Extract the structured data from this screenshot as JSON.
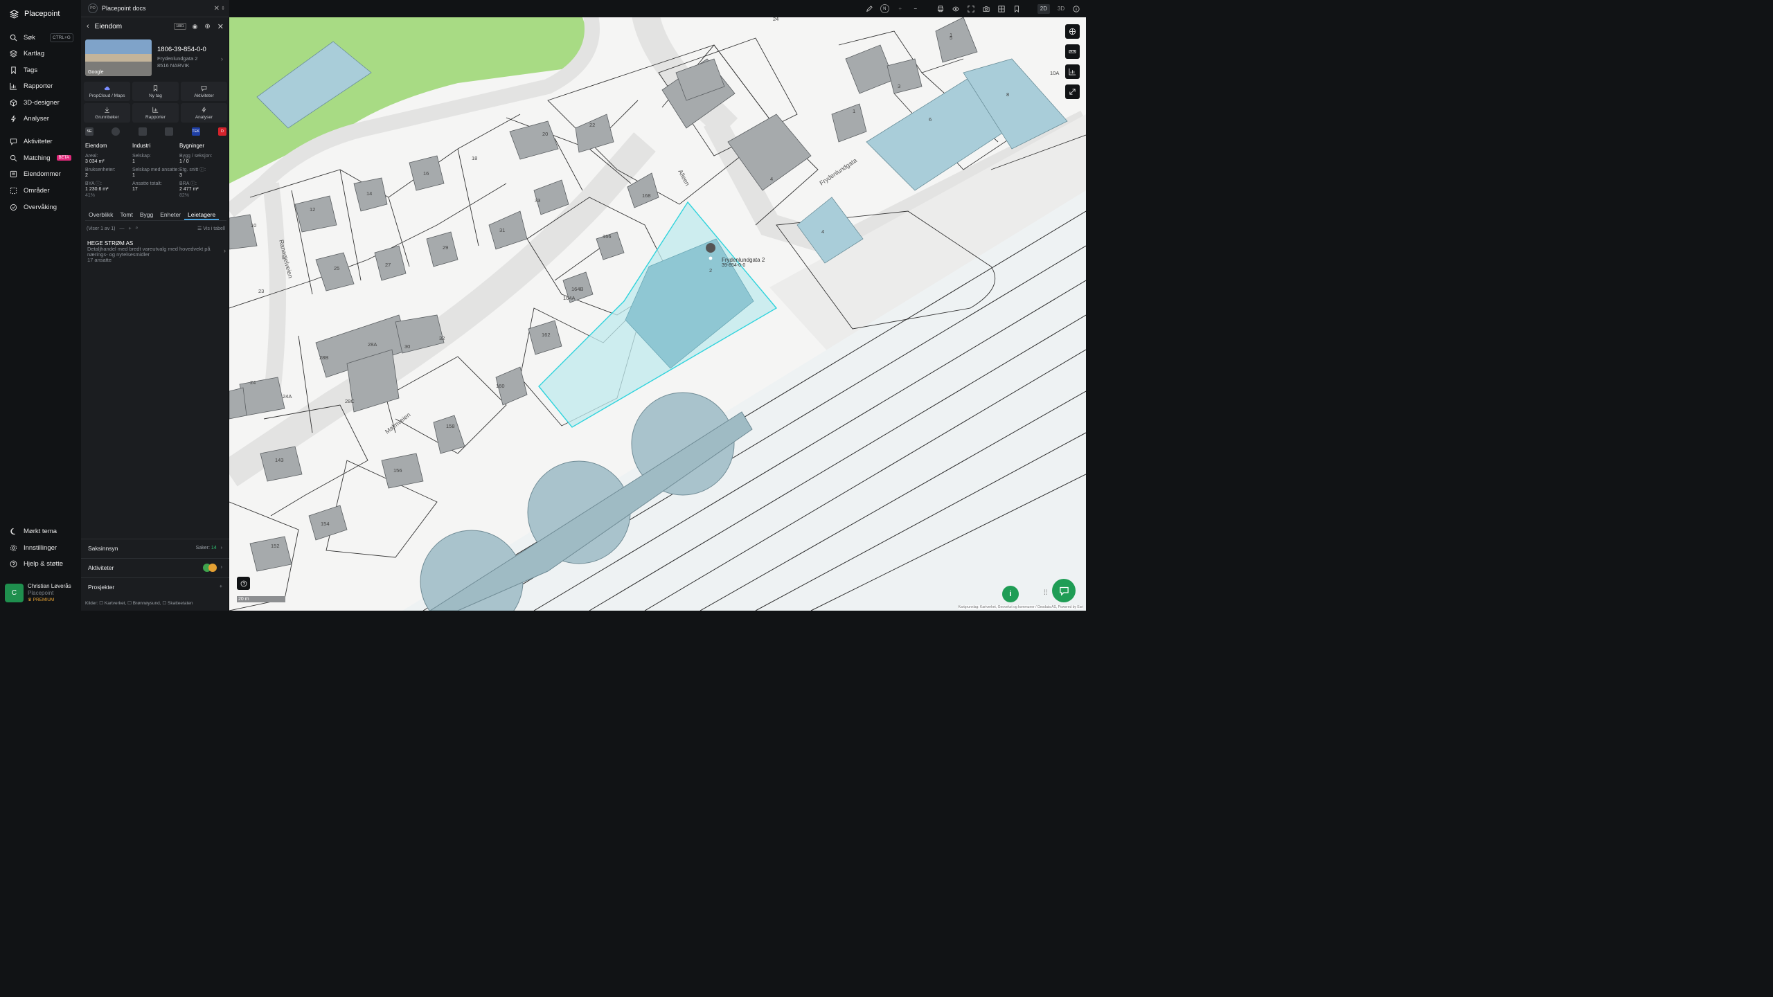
{
  "app": {
    "name": "Placepoint"
  },
  "nav": {
    "items": [
      {
        "label": "Søk",
        "shortcut": "CTRL+G",
        "icon": "search-icon"
      },
      {
        "label": "Kartlag",
        "icon": "layers-icon"
      },
      {
        "label": "Tags",
        "icon": "bookmark-icon"
      },
      {
        "label": "Rapporter",
        "icon": "chart-icon"
      },
      {
        "label": "3D-designer",
        "icon": "cube-icon"
      },
      {
        "label": "Analyser",
        "icon": "bolt-icon"
      },
      {
        "label": "Aktiviteter",
        "icon": "chat-icon"
      },
      {
        "label": "Matching",
        "badge": "BETA",
        "icon": "match-icon"
      },
      {
        "label": "Eiendommer",
        "icon": "list-icon"
      },
      {
        "label": "Områder",
        "icon": "area-icon"
      },
      {
        "label": "Overvåking",
        "icon": "eye-check-icon"
      }
    ],
    "bottom": [
      {
        "label": "Mørkt tema",
        "icon": "moon-icon"
      },
      {
        "label": "Innstillinger",
        "icon": "gear-icon"
      },
      {
        "label": "Hjelp & støtte",
        "icon": "help-icon"
      }
    ],
    "user": {
      "initial": "C",
      "name": "Christian Løverås",
      "org": "Placepoint",
      "plan": "PREMIUM"
    }
  },
  "panel": {
    "tab_badge": "PD",
    "tab_title": "Placepoint docs",
    "title": "Eiendom",
    "header_badge": "1881",
    "photo_credit": "Google",
    "property_id": "1806-39-854-0-0",
    "address_line1": "Frydenlundgata 2",
    "address_line2": "8516 NARVIK",
    "actions": [
      {
        "label": "PropCloud / Maps",
        "icon": "cloud-icon"
      },
      {
        "label": "Ny tag",
        "icon": "bookmark-icon"
      },
      {
        "label": "Aktiviteter",
        "icon": "chat-icon"
      },
      {
        "label": "Grunnbøker",
        "icon": "download-icon"
      },
      {
        "label": "Rapporter",
        "icon": "chart-icon"
      },
      {
        "label": "Analyser",
        "icon": "bolt-icon"
      }
    ],
    "sources": [
      {
        "label": "SE",
        "color": "#3a3d42"
      },
      {
        "label": "",
        "color": "#3a3d42"
      },
      {
        "label": "",
        "color": "#3a3d42"
      },
      {
        "label": "",
        "color": "#3a3d42"
      },
      {
        "label": "TEK",
        "color": "#1f3fa5"
      },
      {
        "label": "D",
        "color": "#d4232b"
      }
    ],
    "stats": {
      "eiendom": {
        "header": "Eiendom",
        "areal_label": "Areal:",
        "areal": "3 034 m²",
        "bruks_label": "Bruksenheter:",
        "bruks": "2",
        "bya_label": "BYA ⓘ:",
        "bya": "1 230.6 m²",
        "bya_pct": "41%"
      },
      "industri": {
        "header": "Industri",
        "selskap_label": "Selskap:",
        "selskap": "1",
        "selskap_ansatte_label": "Selskap med ansatte:",
        "selskap_ansatte": "1",
        "ansatte_label": "Ansatte totalt:",
        "ansatte": "17"
      },
      "bygninger": {
        "header": "Bygninger",
        "bygg_label": "Bygg / seksjon:",
        "bygg": "1 / 0",
        "etg_label": "Etg. snitt ⓘ:",
        "etg": "3",
        "bra_label": "BRA ⓘ:",
        "bra": "2 477 m²",
        "bra_pct": "82%"
      }
    },
    "tabs": [
      "Overblikk",
      "Tomt",
      "Bygg",
      "Enheter",
      "Leietagere"
    ],
    "active_tab": "Leietagere",
    "list_count": "(Viser 1 av 1)",
    "vis_i_tabell": "Vis i tabell",
    "tenant": {
      "name": "HEGE STRØM AS",
      "desc": "Detaljhandel med bredt vareutvalg med hovedvekt på nærings- og nytelsesmidler",
      "employees": "17 ansatte"
    },
    "saksinnsyn": {
      "label": "Saksinnsyn",
      "saker_label": "Saker:",
      "saker": "14"
    },
    "aktiviteter": {
      "label": "Aktiviteter"
    },
    "prosjekter": {
      "label": "Prosjekter"
    },
    "kilder": "Kilder: ☐ Kartverket, ☐ Brønnøysund, ☐ Skatteetaten"
  },
  "toolbar": {
    "north": "N",
    "mode_2d": "2D",
    "mode_3d": "3D"
  },
  "map": {
    "streets": [
      "Frydenlundgata",
      "Alleen",
      "Ranagjelveien",
      "Malmveien"
    ],
    "house_numbers": [
      "1",
      "3",
      "5",
      "6",
      "8",
      "10A",
      "24",
      "1",
      "4",
      "4",
      "20",
      "22",
      "18",
      "16",
      "14",
      "12",
      "10",
      "25",
      "27",
      "29",
      "31",
      "33",
      "168",
      "166",
      "164B",
      "164A",
      "162",
      "160",
      "158",
      "156",
      "154",
      "152",
      "143",
      "24A",
      "24",
      "28A",
      "28B",
      "28C",
      "30",
      "32",
      "23",
      "2"
    ],
    "selected_address": "Frydenlundgata 2",
    "selected_id": "39-854-0-0",
    "scale": "20 m",
    "attribution": "Kartgrunnlag: Kartverket, Geovekst og kommuner / Geodata AS, Powered by Esri",
    "accent": "#2fd3dc",
    "parcel_fill": "#bfe9ee",
    "building_fill": "#8fc7d3"
  }
}
